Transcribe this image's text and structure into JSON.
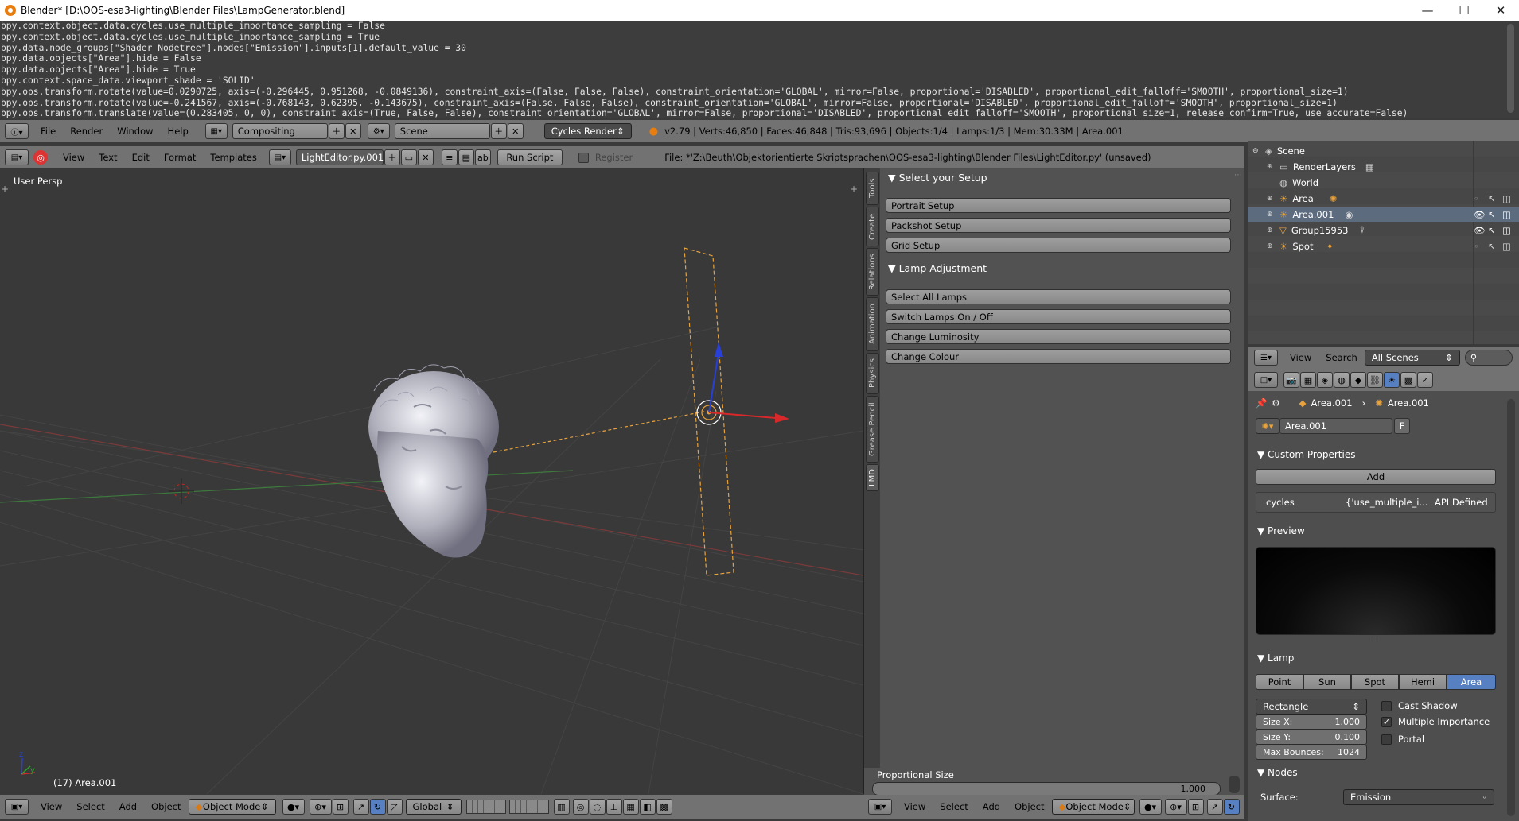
{
  "window": {
    "title": "Blender* [D:\\OOS-esa3-lighting\\Blender Files\\LampGenerator.blend]",
    "minimize": "—",
    "maximize": "☐",
    "close": "✕"
  },
  "info_log": [
    "bpy.context.object.data.cycles.use_multiple_importance_sampling = False",
    "bpy.context.object.data.cycles.use_multiple_importance_sampling = True",
    "bpy.data.node_groups[\"Shader Nodetree\"].nodes[\"Emission\"].inputs[1].default_value = 30",
    "bpy.data.objects[\"Area\"].hide = False",
    "bpy.data.objects[\"Area\"].hide = True",
    "bpy.context.space_data.viewport_shade = 'SOLID'",
    "bpy.ops.transform.rotate(value=0.0290725, axis=(-0.296445, 0.951268, -0.0849136), constraint_axis=(False, False, False), constraint_orientation='GLOBAL', mirror=False, proportional='DISABLED', proportional_edit_falloff='SMOOTH', proportional_size=1)",
    "bpy.ops.transform.rotate(value=-0.241567, axis=(-0.768143, 0.62395, -0.143675), constraint_axis=(False, False, False), constraint_orientation='GLOBAL', mirror=False, proportional='DISABLED', proportional_edit_falloff='SMOOTH', proportional_size=1)",
    "bpy.ops.transform.translate(value=(0.283405, 0, 0), constraint_axis=(True, False, False), constraint_orientation='GLOBAL', mirror=False, proportional='DISABLED', proportional_edit_falloff='SMOOTH', proportional_size=1, release_confirm=True, use_accurate=False)"
  ],
  "info_header": {
    "menus": [
      "File",
      "Render",
      "Window",
      "Help"
    ],
    "layout": "Compositing",
    "scene": "Scene",
    "engine": "Cycles Render",
    "stats": "v2.79 | Verts:46,850 | Faces:46,848 | Tris:93,696 | Objects:1/4 | Lamps:1/3 | Mem:30.33M | Area.001"
  },
  "text_header": {
    "menus": [
      "View",
      "Text",
      "Edit",
      "Format",
      "Templates"
    ],
    "filename": "LightEditor.py.001",
    "run_script": "Run Script",
    "register": "Register",
    "file_path": "File: *'Z:\\Beuth\\Objektorientierte Skriptsprachen\\OOS-esa3-lighting\\Blender Files\\LightEditor.py' (unsaved)"
  },
  "viewport": {
    "label": "User Persp",
    "object_info": "(17) Area.001",
    "tabs": [
      "Tools",
      "Create",
      "Relations",
      "Animation",
      "Physics",
      "Grease Pencil",
      "LMD"
    ]
  },
  "script_panel": {
    "setup_title": "Select your Setup",
    "setup_buttons": [
      "Portrait Setup",
      "Packshot Setup",
      "Grid Setup"
    ],
    "lamp_title": "Lamp Adjustment",
    "lamp_buttons": [
      "Select All Lamps",
      "Switch Lamps On / Off",
      "Change Luminosity",
      "Change Colour"
    ],
    "prop_label": "Proportional Size",
    "prop_value": "1.000"
  },
  "view3d_header": {
    "menus": [
      "View",
      "Select",
      "Add",
      "Object"
    ],
    "mode": "Object Mode",
    "orientation": "Global"
  },
  "outliner": {
    "items": [
      {
        "name": "Scene",
        "icon": "scene-icon"
      },
      {
        "name": "RenderLayers",
        "icon": "renderlayers-icon"
      },
      {
        "name": "World",
        "icon": "world-icon"
      },
      {
        "name": "Area",
        "icon": "lamp-icon"
      },
      {
        "name": "Area.001",
        "icon": "lamp-icon"
      },
      {
        "name": "Group15953",
        "icon": "mesh-icon"
      },
      {
        "name": "Spot",
        "icon": "lamp-icon"
      }
    ],
    "menus": [
      "View",
      "Search"
    ],
    "filter": "All Scenes"
  },
  "properties": {
    "breadcrumb_obj": "Area.001",
    "breadcrumb_data": "Area.001",
    "datablock": "Area.001",
    "datablock_flag": "F",
    "custom_props_title": "Custom Properties",
    "add_label": "Add",
    "prop_name": "cycles",
    "prop_value": "{'use_multiple_i...",
    "prop_api": "API Defined",
    "preview_title": "Preview",
    "lamp_title": "Lamp",
    "lamp_types": [
      "Point",
      "Sun",
      "Spot",
      "Hemi",
      "Area"
    ],
    "active_lamp_type": "Area",
    "shape": "Rectangle",
    "size_x_label": "Size X:",
    "size_x": "1.000",
    "size_y_label": "Size Y:",
    "size_y": "0.100",
    "max_bounces_label": "Max Bounces:",
    "max_bounces": "1024",
    "cast_shadow": "Cast Shadow",
    "multiple_importance": "Multiple Importance",
    "portal": "Portal",
    "nodes_title": "Nodes",
    "surface_label": "Surface:",
    "surface_value": "Emission"
  },
  "colors": {
    "accent": "#5680c2",
    "selection": "#5d6b7e",
    "lamp_outline": "#e8a33d"
  }
}
